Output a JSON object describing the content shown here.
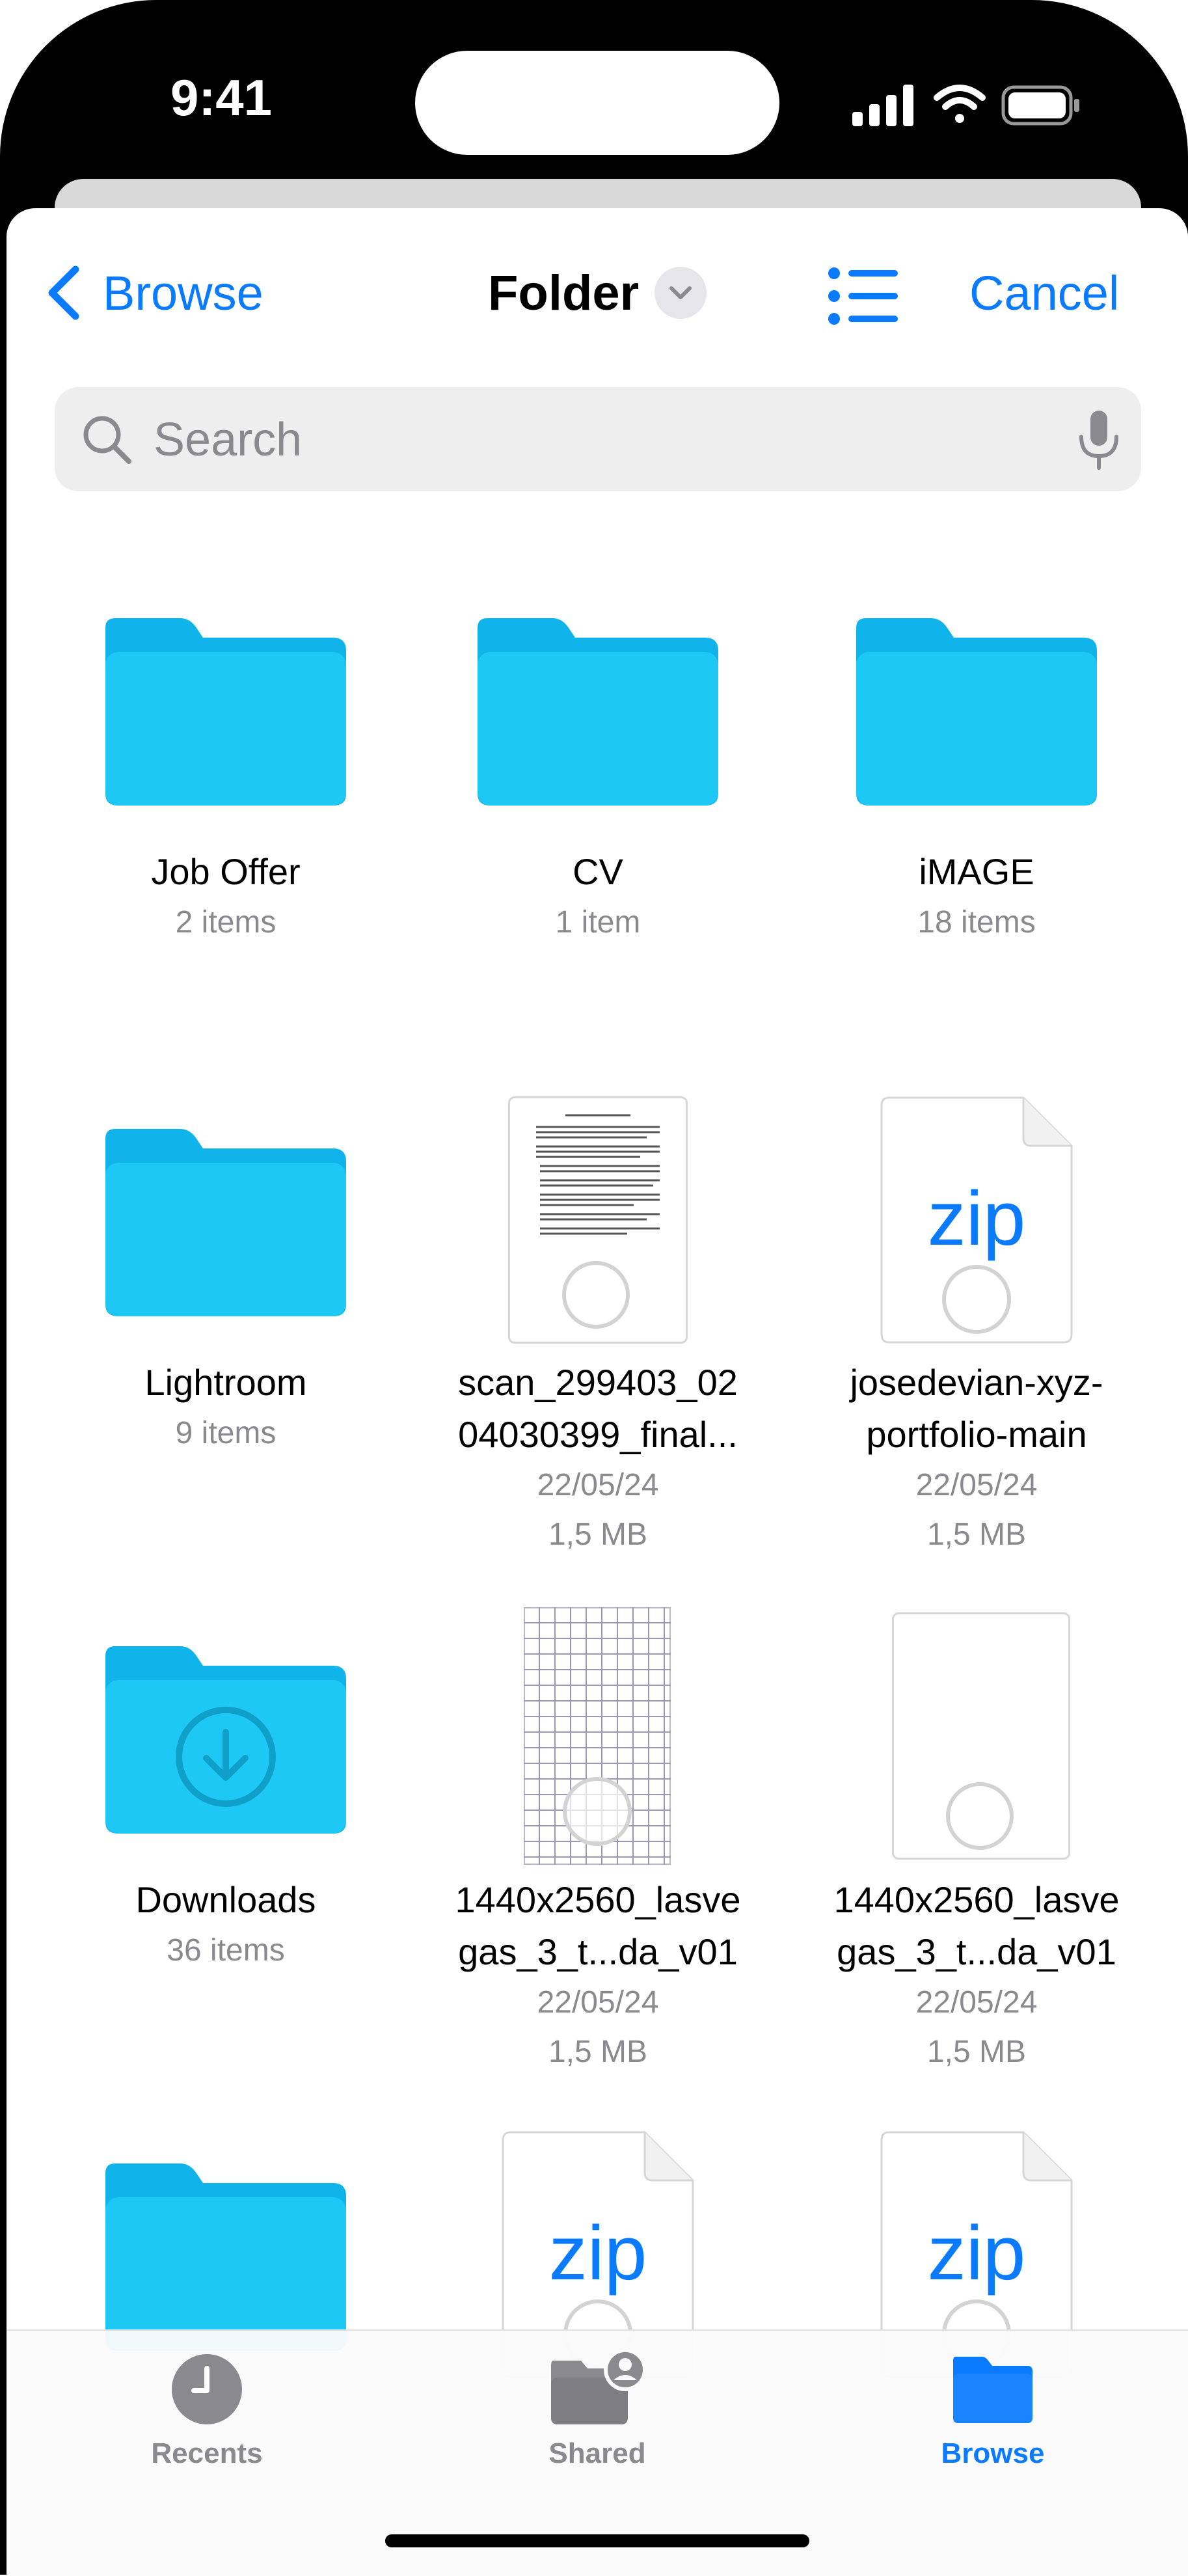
{
  "status": {
    "time": "9:41"
  },
  "nav": {
    "back_label": "Browse",
    "title": "Folder",
    "cancel_label": "Cancel"
  },
  "search": {
    "placeholder": "Search"
  },
  "items": [
    {
      "name": "Job Offer",
      "meta": "2 items",
      "kind": "folder"
    },
    {
      "name": "CV",
      "meta": "1 item",
      "kind": "folder"
    },
    {
      "name": "iMAGE",
      "meta": "18 items",
      "kind": "folder"
    },
    {
      "name": "Lightroom",
      "meta": "9 items",
      "kind": "folder"
    },
    {
      "name_line1": "scan_299403_02",
      "name_line2": "04030399_final...",
      "date": "22/05/24",
      "size": "1,5 MB",
      "kind": "scanned-document"
    },
    {
      "name_line1": "josedevian-xyz-",
      "name_line2": "portfolio-main",
      "date": "22/05/24",
      "size": "1,5 MB",
      "kind": "zip",
      "badge": "zip"
    },
    {
      "name": "Downloads",
      "meta": "36 items",
      "kind": "downloads-folder"
    },
    {
      "name_line1": "1440x2560_lasve",
      "name_line2": "gas_3_t...da_v01",
      "date": "22/05/24",
      "size": "1,5 MB",
      "kind": "grid-image"
    },
    {
      "name_line1": "1440x2560_lasve",
      "name_line2": "gas_3_t...da_v01",
      "date": "22/05/24",
      "size": "1,5 MB",
      "kind": "blank-image"
    },
    {
      "kind": "folder"
    },
    {
      "kind": "zip",
      "badge": "zip"
    },
    {
      "kind": "zip",
      "badge": "zip"
    }
  ],
  "tabs": [
    {
      "label": "Recents",
      "icon": "clock-icon",
      "active": false
    },
    {
      "label": "Shared",
      "icon": "shared-folder-icon",
      "active": false
    },
    {
      "label": "Browse",
      "icon": "folder-icon",
      "active": true
    }
  ],
  "colors": {
    "accent": "#0a7aff",
    "folder": "#1ec8f5",
    "folder_tab": "#10b4eb",
    "inactive": "#8a8a8e"
  }
}
